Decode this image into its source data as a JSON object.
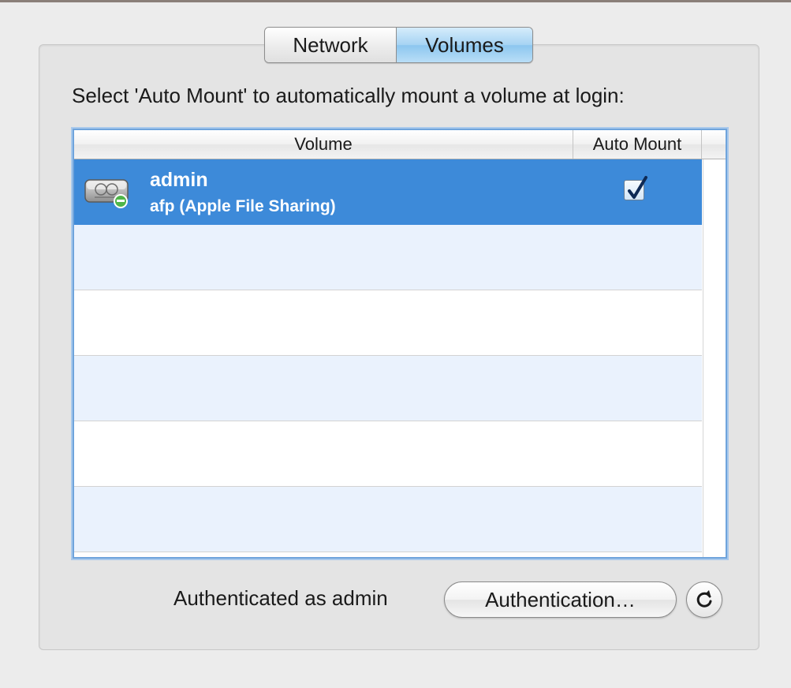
{
  "tabs": [
    {
      "label": "Network",
      "selected": false
    },
    {
      "label": "Volumes",
      "selected": true
    }
  ],
  "instruction": "Select 'Auto Mount' to automatically mount a volume at login:",
  "table": {
    "columns": [
      "Volume",
      "Auto Mount"
    ],
    "rows": [
      {
        "name": "admin",
        "protocol": "afp (Apple File Sharing)",
        "auto_mount": true,
        "selected": true,
        "icon": "network-drive-icon"
      }
    ]
  },
  "footer": {
    "auth_status": "Authenticated as admin",
    "auth_button_label": "Authentication…",
    "refresh_icon": "refresh-icon"
  },
  "colors": {
    "selection": "#3d8ad9",
    "stripe": "#eaf2fd",
    "focus_ring": "#6fa4dc"
  }
}
